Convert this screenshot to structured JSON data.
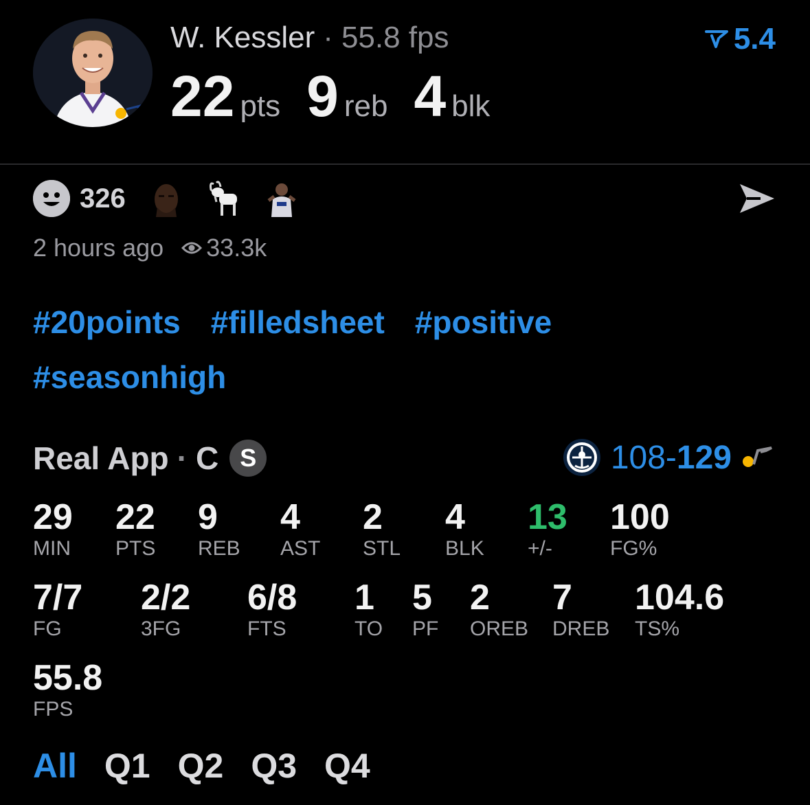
{
  "player": {
    "name": "W. Kessler",
    "separator": "·",
    "fps_text": "55.8 fps",
    "big_stats": [
      {
        "value": "22",
        "unit": "pts"
      },
      {
        "value": "9",
        "unit": "reb"
      },
      {
        "value": "4",
        "unit": "blk"
      }
    ],
    "rating": "5.4"
  },
  "reactions": {
    "count": "326",
    "emoji_icons": [
      "player-face-emoji-icon",
      "goat-emoji-icon",
      "player-celebrating-emoji-icon"
    ]
  },
  "meta": {
    "time_ago": "2 hours ago",
    "views": "33.3k"
  },
  "tags": [
    "#20points",
    "#filledsheet",
    "#positive",
    "#seasonhigh"
  ],
  "game": {
    "source": "Real App",
    "separator": "·",
    "position": "C",
    "badge": "S",
    "away_score": "108",
    "dash": "-",
    "home_score": "129"
  },
  "stats": [
    {
      "value": "29",
      "label": "MIN"
    },
    {
      "value": "22",
      "label": "PTS"
    },
    {
      "value": "9",
      "label": "REB"
    },
    {
      "value": "4",
      "label": "AST"
    },
    {
      "value": "2",
      "label": "STL"
    },
    {
      "value": "4",
      "label": "BLK"
    },
    {
      "value": "13",
      "label": "+/-"
    },
    {
      "value": "100",
      "label": "FG%"
    },
    {
      "value": "7/7",
      "label": "FG"
    },
    {
      "value": "2/2",
      "label": "3FG"
    },
    {
      "value": "6/8",
      "label": "FTS"
    },
    {
      "value": "1",
      "label": "TO"
    },
    {
      "value": "5",
      "label": "PF"
    },
    {
      "value": "2",
      "label": "OREB"
    },
    {
      "value": "7",
      "label": "DREB"
    },
    {
      "value": "104.6",
      "label": "TS%"
    },
    {
      "value": "55.8",
      "label": "FPS"
    }
  ],
  "periods": [
    "All",
    "Q1",
    "Q2",
    "Q3",
    "Q4"
  ],
  "colors": {
    "accent": "#2d8ee6",
    "positive": "#2ebd6b",
    "background": "#000000"
  }
}
